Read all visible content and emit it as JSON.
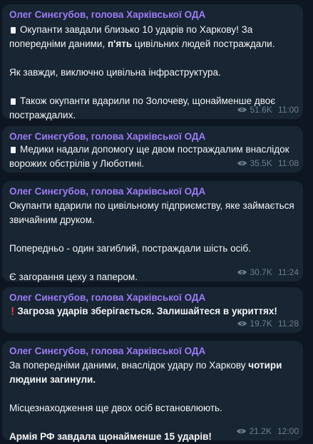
{
  "channel": {
    "author": "Олег Синєгубов, голова Харківської ОДА"
  },
  "colors": {
    "background": "#0e1621",
    "bubble": "#182533",
    "author": "#9d7cf6",
    "meta": "#6d7f8f",
    "alert": "#e8393b"
  },
  "messages": [
    {
      "author": "Олег Синєгубов, голова Харківської ОДА",
      "p1_a": "Окупанти завдали близько 10 ударів по Харкову! За попередніми даними, ",
      "p1_bold": "п'ять",
      "p1_b": " цивільних людей постраждали.",
      "p2": "Як завжди, виключно цивільна інфраструктура.",
      "p3": "Також окупанти вдарили по Золочеву, щонайменше двоє постраждалих.",
      "views": "51.6K",
      "time": "11:00"
    },
    {
      "author": "Олег Синєгубов, голова Харківської ОДА",
      "p1": "Медики надали допомогу ще двом постраждалим внаслідок ворожих обстрілів у Люботині.",
      "views": "35.5K",
      "time": "11:08"
    },
    {
      "author": "Олег Синєгубов, голова Харківської ОДА",
      "p1": "Окупанти вдарили по цивільному підприємству, яке займається звичайним друком.",
      "p2": "Попередньо - один загиблий, постраждали шість осіб.",
      "p3": "Є загорання цеху з папером.",
      "views": "30.7K",
      "time": "11:24"
    },
    {
      "author": "Олег Синєгубов, голова Харківської ОДА",
      "p1": "Загроза ударів зберігається. Залишайтеся в укриттях!",
      "views": "19.7K",
      "time": "11:28"
    },
    {
      "author": "Олег Синєгубов, голова Харківської ОДА",
      "p1_a": "За попередніми даними, внаслідок удару по Харкову ",
      "p1_bold": "чотири людини загинули.",
      "p2": "Місцезнаходження ще двох осіб встановлюють.",
      "p3": "Армія РФ завдала щонайменше 15 ударів!",
      "views": "21.2K",
      "time": "12:00"
    }
  ]
}
